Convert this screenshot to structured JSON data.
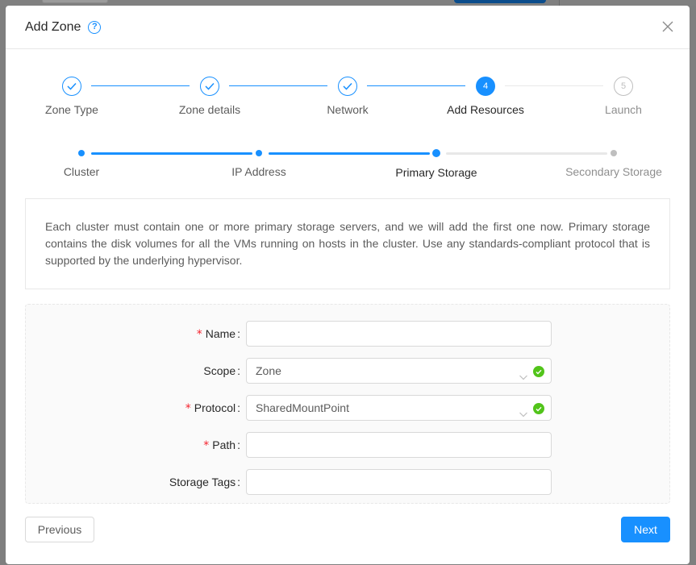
{
  "modal": {
    "title": "Add Zone",
    "help_icon": "question-circle-icon",
    "close_icon": "close-icon"
  },
  "steps": [
    {
      "label": "Zone Type",
      "status": "finished",
      "number": "1"
    },
    {
      "label": "Zone details",
      "status": "finished",
      "number": "2"
    },
    {
      "label": "Network",
      "status": "finished",
      "number": "3"
    },
    {
      "label": "Add Resources",
      "status": "process",
      "number": "4"
    },
    {
      "label": "Launch",
      "status": "wait",
      "number": "5"
    }
  ],
  "substeps": [
    {
      "label": "Cluster",
      "status": "finished"
    },
    {
      "label": "IP Address",
      "status": "finished"
    },
    {
      "label": "Primary Storage",
      "status": "process"
    },
    {
      "label": "Secondary Storage",
      "status": "wait"
    }
  ],
  "info": {
    "text": "Each cluster must contain one or more primary storage servers, and we will add the first one now. Primary storage contains the disk volumes for all the VMs running on hosts in the cluster. Use any standards-compliant protocol that is supported by the underlying hypervisor."
  },
  "form": {
    "name": {
      "label": "Name",
      "required": true,
      "value": ""
    },
    "scope": {
      "label": "Scope",
      "required": false,
      "value": "Zone"
    },
    "protocol": {
      "label": "Protocol",
      "required": true,
      "value": "SharedMountPoint"
    },
    "path": {
      "label": "Path",
      "required": true,
      "value": ""
    },
    "storage_tags": {
      "label": "Storage Tags",
      "required": false,
      "value": ""
    }
  },
  "buttons": {
    "previous": "Previous",
    "next": "Next"
  },
  "colors": {
    "primary": "#1890ff",
    "success": "#52c41a",
    "required": "#f5222d"
  }
}
